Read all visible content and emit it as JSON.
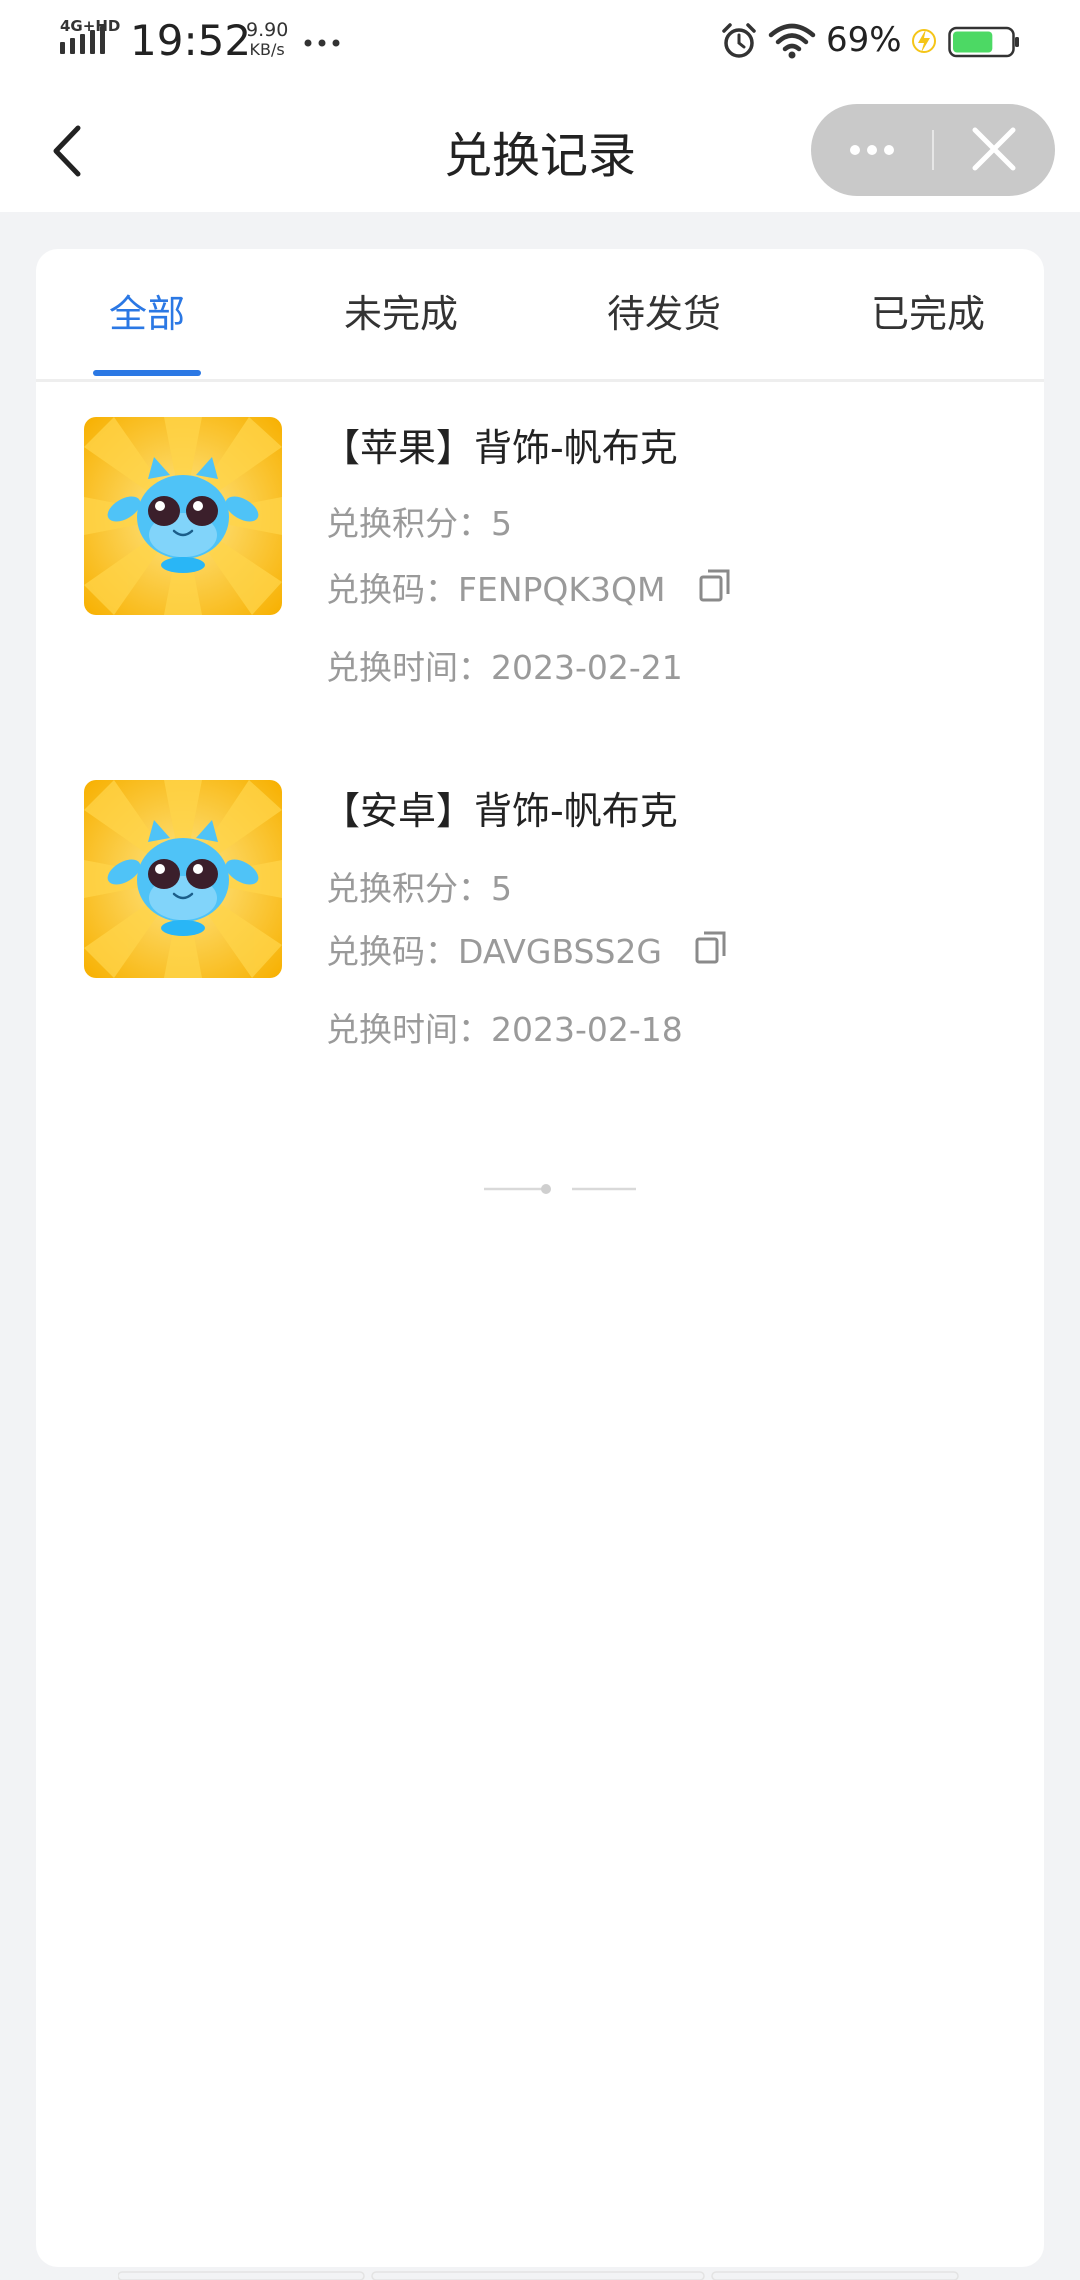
{
  "status_bar": {
    "network": "4G+HD",
    "time": "19:52",
    "speed_value": "9.90",
    "speed_unit": "KB/s",
    "battery_percent": "69%",
    "battery_level": 0.69,
    "icons": [
      "signal-icon",
      "more-dots-icon",
      "alarm-icon",
      "wifi-icon",
      "charging-bolt-icon",
      "battery-icon"
    ]
  },
  "nav": {
    "title": "兑换记录",
    "back_icon": "chevron-left-icon",
    "more_icon": "more-dots-icon",
    "close_icon": "close-icon"
  },
  "tabs": [
    {
      "label": "全部",
      "active": true
    },
    {
      "label": "未完成",
      "active": false
    },
    {
      "label": "待发货",
      "active": false
    },
    {
      "label": "已完成",
      "active": false
    }
  ],
  "records": [
    {
      "title": "【苹果】背饰-帆布克",
      "points_label": "兑换积分：",
      "points": "5",
      "code_label": "兑换码：",
      "code": "FENPQK3QM",
      "time_label": "兑换时间：",
      "time": "2023-02-21",
      "copy_icon": "copy-icon"
    },
    {
      "title": "【安卓】背饰-帆布克",
      "points_label": "兑换积分：",
      "points": "5",
      "code_label": "兑换码：",
      "code": "DAVGBSS2G",
      "time_label": "兑换时间：",
      "time": "2023-02-18",
      "copy_icon": "copy-icon"
    }
  ],
  "colors": {
    "accent": "#2b78e4",
    "page_bg": "#f2f3f5",
    "muted_text": "#9a9a9a",
    "capsule_bg": "#c9c9c9",
    "battery_green": "#4cd964",
    "thumb_yellow": "#f7b500"
  }
}
